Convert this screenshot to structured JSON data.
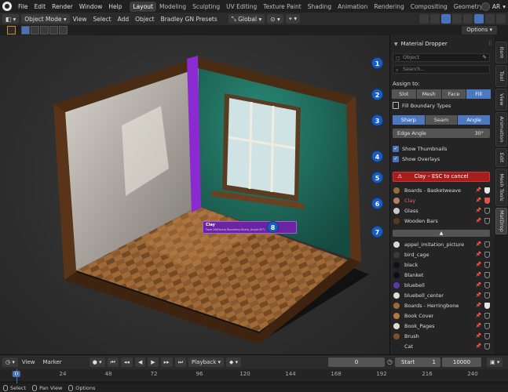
{
  "menubar": {
    "items": [
      "File",
      "Edit",
      "Render",
      "Window",
      "Help"
    ],
    "workspaces": [
      "Layout",
      "Modeling",
      "Sculpting",
      "UV Editing",
      "Texture Paint",
      "Shading",
      "Animation",
      "Rendering",
      "Compositing",
      "Geometry Nodes"
    ],
    "active_workspace": "Layout",
    "user_initials": "AR"
  },
  "header": {
    "mode": "Object Mode",
    "menus": [
      "View",
      "Select",
      "Add",
      "Object",
      "Bradley GN Presets"
    ],
    "orientation": "Global",
    "options": "Options"
  },
  "viewport": {
    "tooltip_title": "Clay",
    "tooltip_detail": "Face:16(Faces) Boundary:Sharp_Angle:30°)",
    "badge_8": "8"
  },
  "panel": {
    "title": "Material Dropper",
    "object_placeholder": "Object",
    "search_placeholder": "Search...",
    "assign_to_label": "Assign to:",
    "assign_modes": [
      "Slot",
      "Mesh",
      "Face",
      "Fill"
    ],
    "active_assign_mode": "Fill",
    "fill_boundary_label": "Fill Boundary Types",
    "boundary_types": [
      "Sharp",
      "Seam",
      "Angle"
    ],
    "edge_angle_label": "Edge Angle",
    "edge_angle_value": "30°",
    "show_thumbnails": "Show Thumbnails",
    "show_overlays": "Show Overlays",
    "cancel_label": "Clay  –  ESC to cancel",
    "up_arrow": "▲",
    "badges": [
      "1",
      "2",
      "3",
      "4",
      "5",
      "6",
      "7"
    ],
    "pinned_materials": [
      {
        "name": "Boards - Basketweave",
        "color": "#9a6a3c",
        "active": false,
        "fake_user": true
      },
      {
        "name": "Clay",
        "color": "#b08060",
        "active": true,
        "fake_user": true
      },
      {
        "name": "Glass",
        "color": "#c9c9c9",
        "active": false,
        "fake_user": false
      },
      {
        "name": "Wooden Bars",
        "color": "#5a3a20",
        "active": false,
        "fake_user": false
      }
    ],
    "materials": [
      {
        "name": "appel_imitation_picture",
        "color": "#d8d8d8",
        "fake_user": false
      },
      {
        "name": "bird_cage",
        "color": "#3a3a3a",
        "fake_user": false
      },
      {
        "name": "black",
        "color": "#111111",
        "fake_user": false
      },
      {
        "name": "Blanket",
        "color": "#0d0d1a",
        "fake_user": false
      },
      {
        "name": "bluebell",
        "color": "#5a3aa8",
        "fake_user": false
      },
      {
        "name": "bluebell_center",
        "color": "#e0e0d0",
        "fake_user": false
      },
      {
        "name": "Boards - Herringbone",
        "color": "#9a6a3c",
        "fake_user": true
      },
      {
        "name": "Book Cover",
        "color": "#b07a40",
        "fake_user": false
      },
      {
        "name": "Book_Pages",
        "color": "#e0dcd0",
        "fake_user": false
      },
      {
        "name": "Brush",
        "color": "#7a5030",
        "fake_user": false
      },
      {
        "name": "Cat",
        "color": "#222222",
        "fake_user": false
      }
    ]
  },
  "sidebar_tabs": [
    "Item",
    "Tool",
    "View",
    "Animation",
    "Edit",
    "Mesh Tools",
    "MatDrop"
  ],
  "active_sidebar_tab": "MatDrop",
  "timeline": {
    "menus": [
      "View",
      "Marker"
    ],
    "playback": "Playback",
    "current_frame": "0",
    "start_label": "Start",
    "start_value": "1",
    "end_value": "10000",
    "ticks": [
      "0",
      "24",
      "48",
      "72",
      "96",
      "120",
      "144",
      "168",
      "192",
      "216",
      "240"
    ]
  },
  "statusbar": {
    "items": [
      "Select",
      "Pan View",
      "Options"
    ]
  },
  "colors": {
    "accent": "#4a72b8",
    "badge": "#1b5cbf",
    "cancel": "#a61d1d",
    "wall_green": "#1f6b5c"
  }
}
